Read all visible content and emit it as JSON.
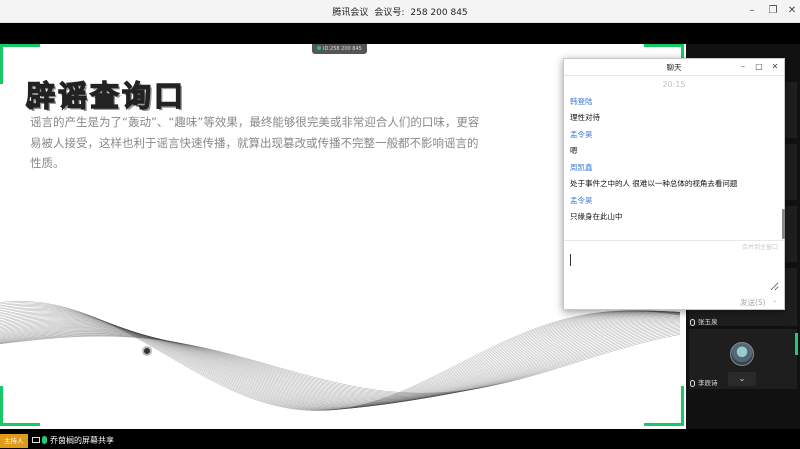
{
  "window": {
    "app_name": "腾讯会议",
    "meeting_label": "会议号:",
    "meeting_id": "258 200 845"
  },
  "share_badge": {
    "text": "ID:258 200 845"
  },
  "slide": {
    "title": "辟谣查询口",
    "body": "谣言的产生是为了“轰动”、“趣味”等效果，最终能够很完美或非常迎合人们的口味，更容易被人接受，这样也利于谣言快速传播，就算出现篡改或传播不完整一般都不影响谣言的性质。"
  },
  "chat": {
    "title": "聊天",
    "time": "20:15",
    "messages": [
      {
        "sender": "韩登陆",
        "text": "理性对待"
      },
      {
        "sender": "孟令昊",
        "text": "嗯"
      },
      {
        "sender": "周凯鑫",
        "text": "处于事件之中的人 很难以一种总体的视角去看问题"
      },
      {
        "sender": "孟令昊",
        "text": "只缘身在此山中"
      }
    ],
    "send_to": "合并到主窗口",
    "send_label": "发送(S)"
  },
  "participants": [
    {
      "name": "张玉泉"
    },
    {
      "name": "李辰诗"
    }
  ],
  "bottom": {
    "host_badge": "主持人",
    "sharer": "乔茵榈的屏幕共享"
  },
  "colors": {
    "accent_green": "#17c964",
    "host_orange": "#e09b1a",
    "chat_name_blue": "#3a78d8"
  }
}
